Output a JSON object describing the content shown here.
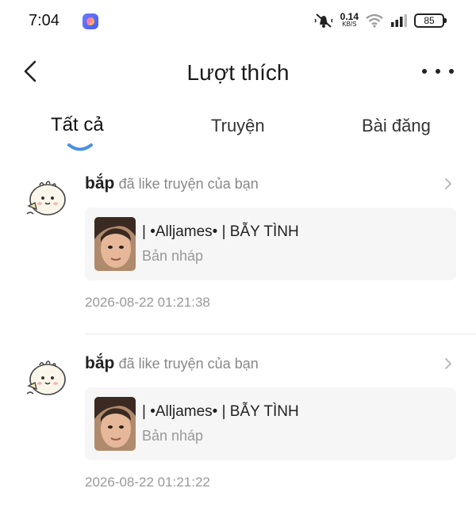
{
  "status_bar": {
    "time": "7:04",
    "net_speed_value": "0.14",
    "net_speed_unit": "KB/S",
    "battery": "85"
  },
  "header": {
    "title": "Lượt thích"
  },
  "tabs": [
    {
      "label": "Tất cả",
      "active": true
    },
    {
      "label": "Truyện",
      "active": false
    },
    {
      "label": "Bài đăng",
      "active": false
    }
  ],
  "colors": {
    "accent": "#4a90e2",
    "card_bg": "#f6f6f6",
    "secondary_text": "#999999"
  },
  "notifications": [
    {
      "user": "bắp",
      "action": "đã like truyện của bạn",
      "story_title": "| •Alljames• | BẪY TÌNH",
      "story_status": "Bản nháp",
      "timestamp": "2026-08-22 01:21:38"
    },
    {
      "user": "bắp",
      "action": "đã like truyện của bạn",
      "story_title": "| •Alljames• | BẪY TÌNH",
      "story_status": "Bản nháp",
      "timestamp": "2026-08-22 01:21:22"
    }
  ]
}
